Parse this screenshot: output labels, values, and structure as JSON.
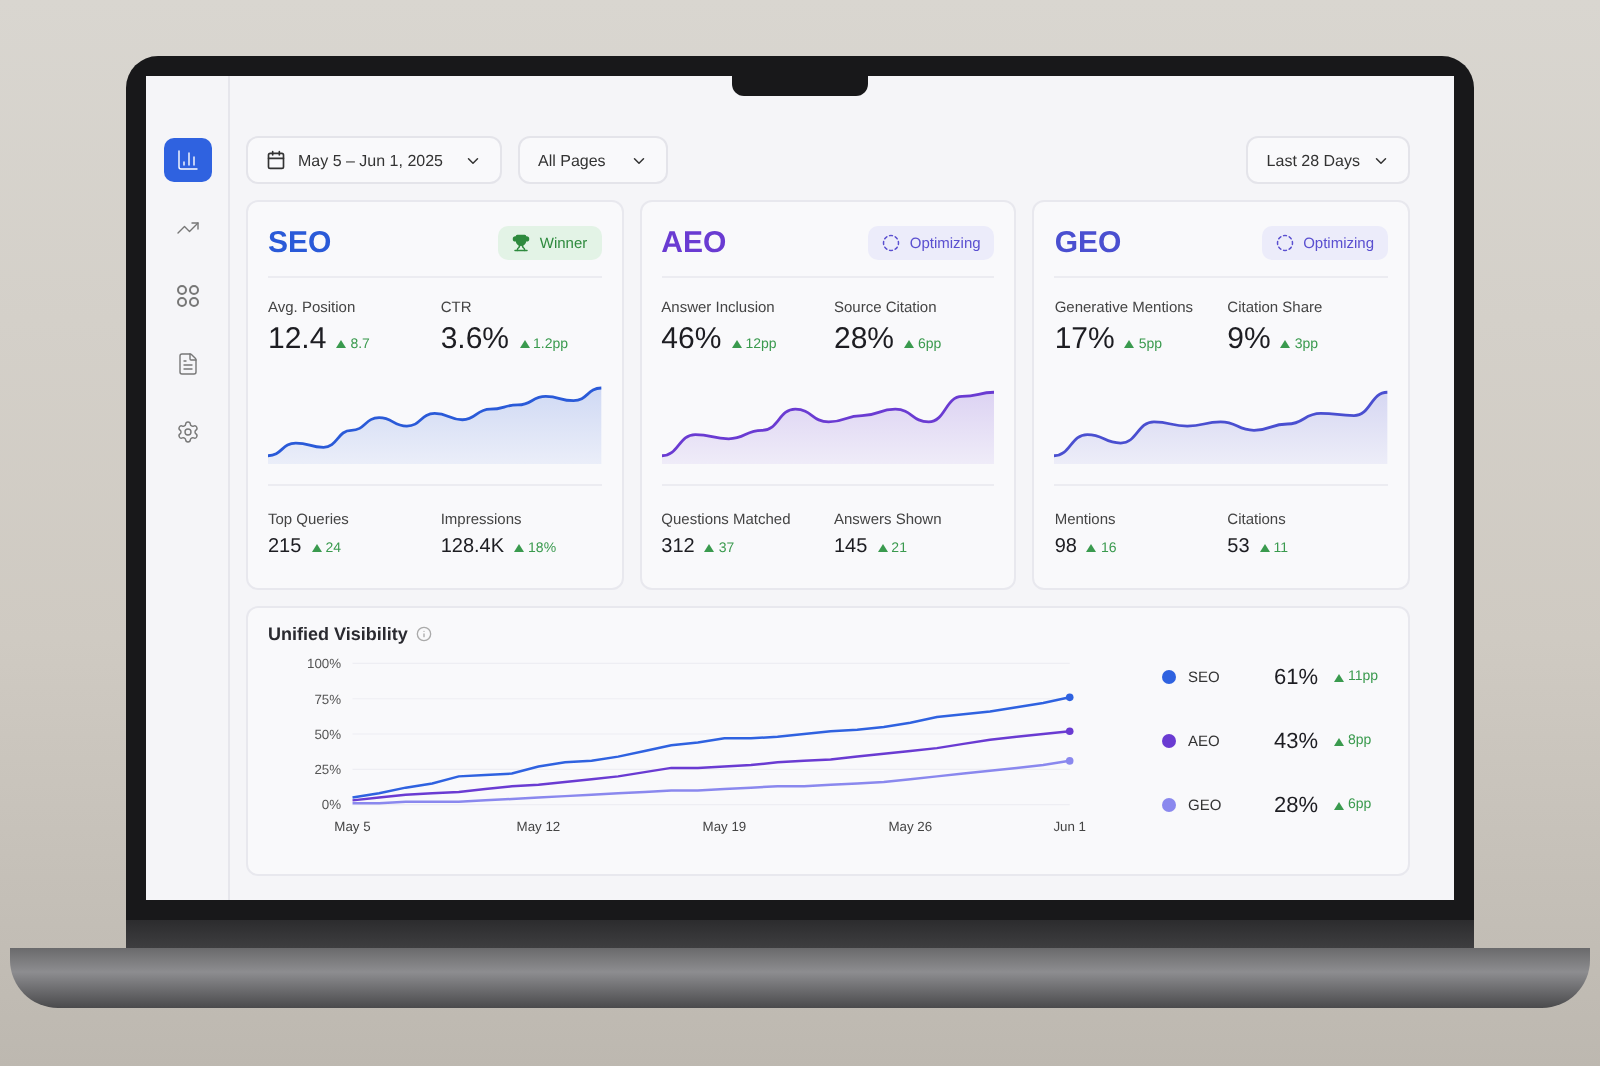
{
  "sidebar": {
    "items": [
      {
        "selected": true
      },
      {
        "selected": false
      },
      {
        "selected": false
      },
      {
        "selected": false
      },
      {
        "selected": false
      }
    ]
  },
  "filters": {
    "date_range": "May 5 – Jun 1, 2025",
    "pages": "All Pages",
    "period": "Last 28 Days"
  },
  "cards": [
    {
      "title": "SEO",
      "color": "#2a5ad8",
      "badge": {
        "kind": "winner",
        "label": "Winner"
      },
      "metrics": [
        {
          "label": "Avg. Position",
          "value": "12.4",
          "delta": "8.7"
        },
        {
          "label": "CTR",
          "value": "3.6%",
          "delta": "1.2pp"
        }
      ],
      "stats": [
        {
          "label": "Top Queries",
          "value": "215",
          "delta": "24"
        },
        {
          "label": "Impressions",
          "value": "128.4K",
          "delta": "18%"
        }
      ]
    },
    {
      "title": "AEO",
      "color": "#6a3bd2",
      "badge": {
        "kind": "optimizing",
        "label": "Optimizing"
      },
      "metrics": [
        {
          "label": "Answer Inclusion",
          "value": "46%",
          "delta": "12pp"
        },
        {
          "label": "Source Citation",
          "value": "28%",
          "delta": "6pp"
        }
      ],
      "stats": [
        {
          "label": "Questions Matched",
          "value": "312",
          "delta": "37"
        },
        {
          "label": "Answers Shown",
          "value": "145",
          "delta": "21"
        }
      ]
    },
    {
      "title": "GEO",
      "color": "#4a4fd0",
      "badge": {
        "kind": "optimizing",
        "label": "Optimizing"
      },
      "metrics": [
        {
          "label": "Generative Mentions",
          "value": "17%",
          "delta": "5pp"
        },
        {
          "label": "Citation Share",
          "value": "9%",
          "delta": "3pp"
        }
      ],
      "stats": [
        {
          "label": "Mentions",
          "value": "98",
          "delta": "16"
        },
        {
          "label": "Citations",
          "value": "53",
          "delta": "11"
        }
      ]
    }
  ],
  "visibility": {
    "title": "Unified Visibility",
    "chart_data": {
      "type": "line",
      "grid": true,
      "categories": [
        "May 5",
        null,
        null,
        null,
        null,
        null,
        null,
        "May 12",
        null,
        null,
        null,
        null,
        null,
        null,
        "May 19",
        null,
        null,
        null,
        null,
        null,
        null,
        "May 26",
        null,
        null,
        null,
        null,
        null,
        "Jun 1"
      ],
      "ylim": [
        0,
        100
      ],
      "yticks": [
        {
          "value": 0,
          "label": "0%"
        },
        {
          "value": 25,
          "label": "25%"
        },
        {
          "value": 50,
          "label": "50%"
        },
        {
          "value": 75,
          "label": "75%"
        },
        {
          "value": 100,
          "label": "100%"
        }
      ],
      "series": [
        {
          "name": "SEO",
          "color": "#2f62e0",
          "values": [
            5,
            8,
            12,
            15,
            20,
            21,
            22,
            27,
            30,
            31,
            34,
            38,
            42,
            44,
            47,
            47,
            48,
            50,
            52,
            53,
            55,
            58,
            62,
            64,
            66,
            69,
            72,
            76
          ]
        },
        {
          "name": "AEO",
          "color": "#6a3bd2",
          "values": [
            3,
            5,
            7,
            8,
            9,
            11,
            13,
            14,
            16,
            18,
            20,
            23,
            26,
            26,
            27,
            28,
            30,
            31,
            32,
            34,
            36,
            38,
            40,
            43,
            46,
            48,
            50,
            52
          ]
        },
        {
          "name": "GEO",
          "color": "#8a88ee",
          "values": [
            1,
            1,
            2,
            2,
            2,
            3,
            4,
            5,
            6,
            7,
            8,
            9,
            10,
            10,
            11,
            12,
            13,
            13,
            14,
            15,
            16,
            18,
            20,
            22,
            24,
            26,
            28,
            31
          ]
        }
      ]
    },
    "legend": [
      {
        "value": "61%",
        "delta": "11pp"
      },
      {
        "value": "43%",
        "delta": "8pp"
      },
      {
        "value": "28%",
        "delta": "6pp"
      }
    ]
  }
}
